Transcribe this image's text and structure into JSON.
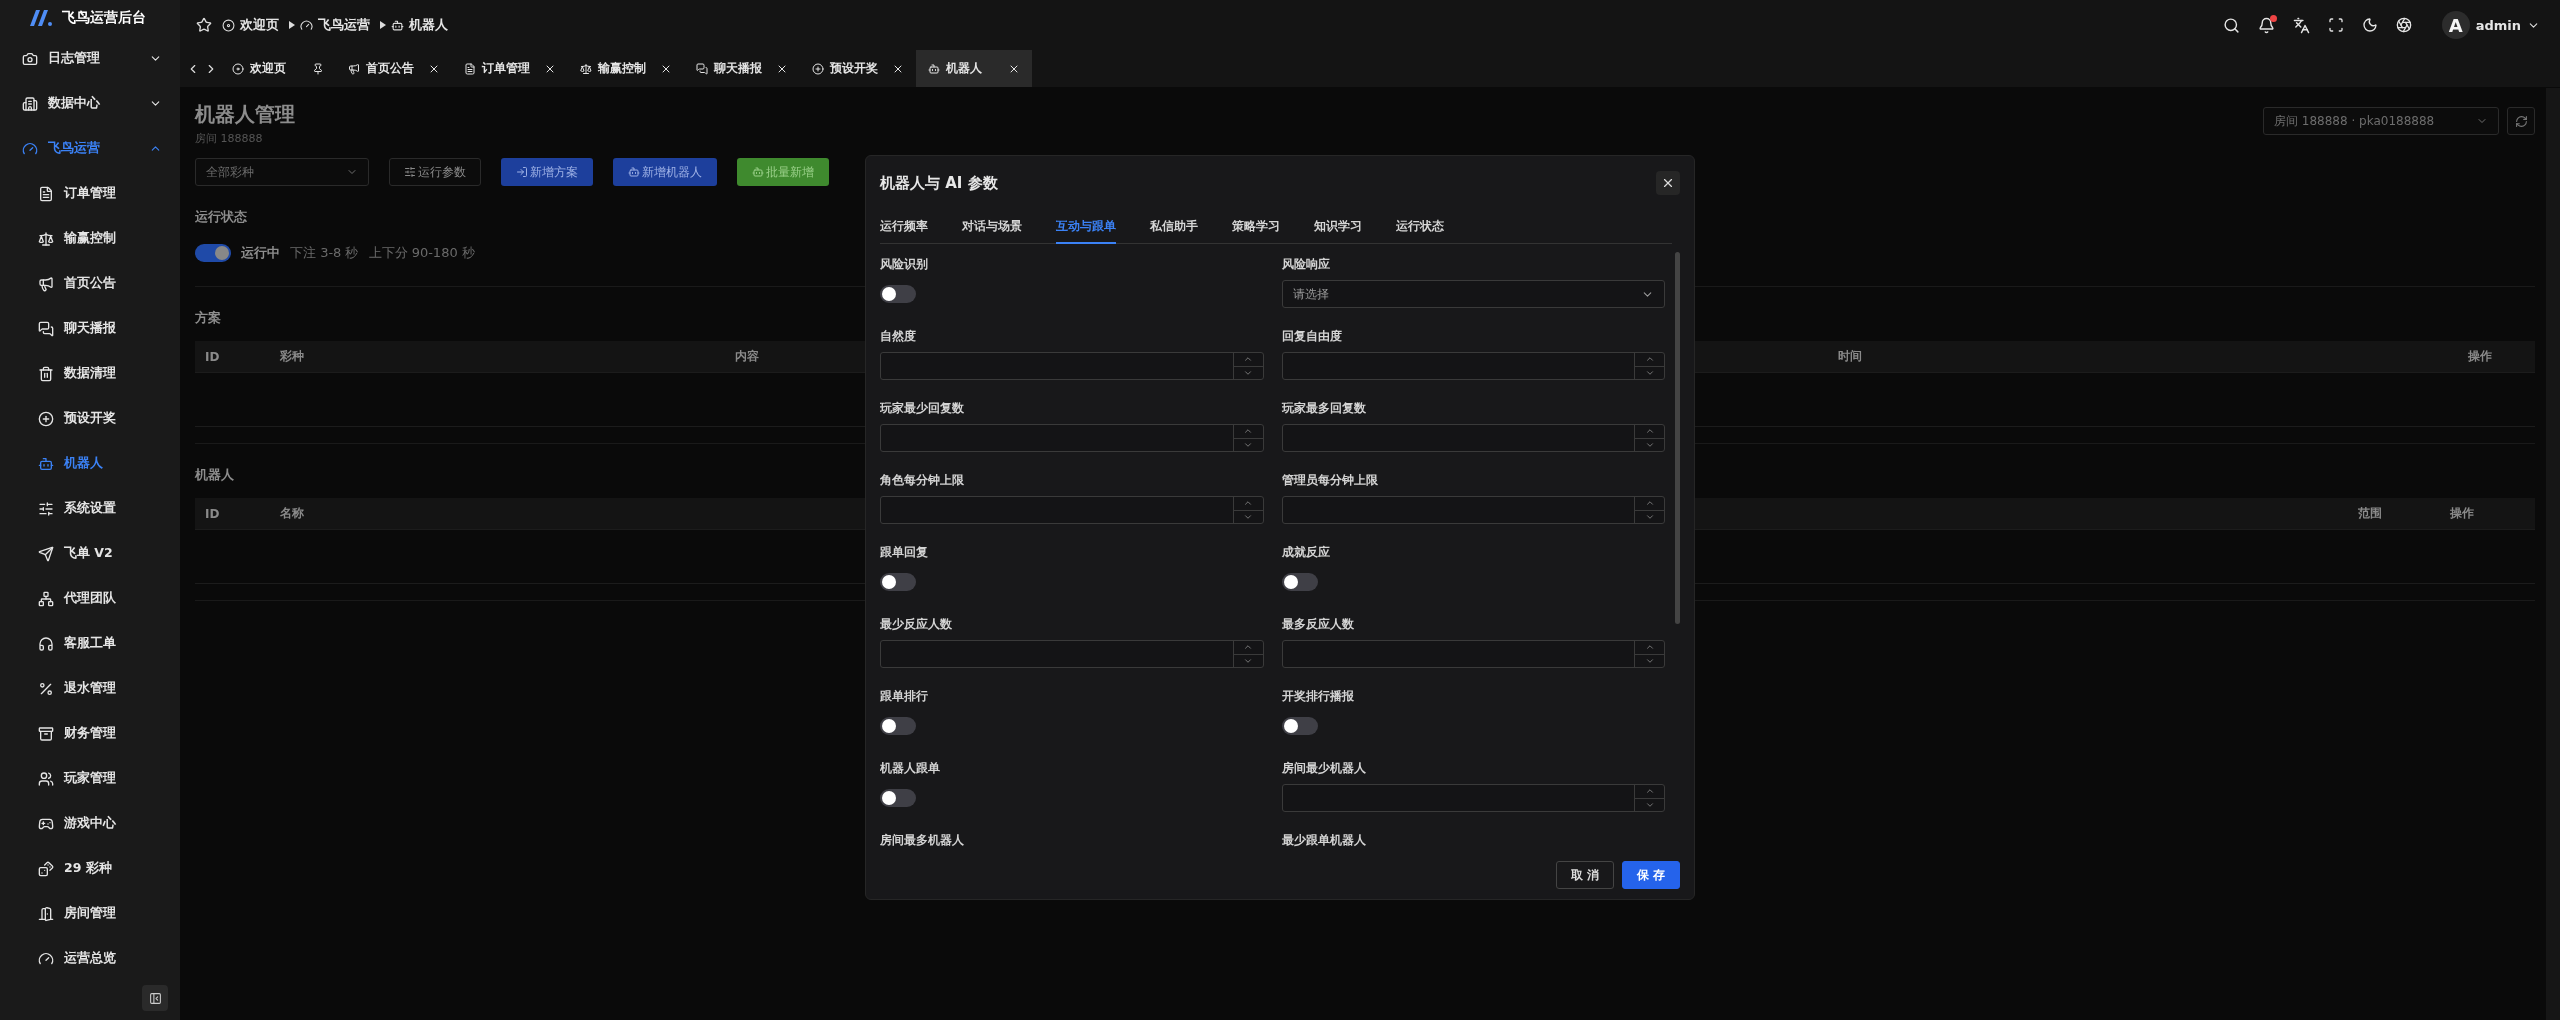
{
  "app": {
    "title": "飞鸟运营后台"
  },
  "sidebar": {
    "items": [
      {
        "label": "日志管理",
        "expanded": false,
        "selected": false
      },
      {
        "label": "数据中心",
        "expanded": false,
        "selected": false
      },
      {
        "label": "飞鸟运营",
        "expanded": true,
        "selected": true,
        "children": [
          {
            "label": "订单管理",
            "selected": false
          },
          {
            "label": "输赢控制",
            "selected": false
          },
          {
            "label": "首页公告",
            "selected": false
          },
          {
            "label": "聊天播报",
            "selected": false
          },
          {
            "label": "数据清理",
            "selected": false
          },
          {
            "label": "预设开奖",
            "selected": false
          },
          {
            "label": "机器人",
            "selected": true
          },
          {
            "label": "系统设置",
            "selected": false
          },
          {
            "label": "飞单 V2",
            "selected": false
          },
          {
            "label": "代理团队",
            "selected": false
          },
          {
            "label": "客服工单",
            "selected": false
          },
          {
            "label": "退水管理",
            "selected": false
          },
          {
            "label": "财务管理",
            "selected": false
          },
          {
            "label": "玩家管理",
            "selected": false
          },
          {
            "label": "游戏中心",
            "selected": false
          },
          {
            "label": "29 彩种",
            "selected": false
          },
          {
            "label": "房间管理",
            "selected": false
          },
          {
            "label": "运营总览",
            "selected": false
          }
        ]
      }
    ]
  },
  "breadcrumb": [
    "欢迎页",
    "飞鸟运营",
    "机器人"
  ],
  "notifications": {
    "unread": true
  },
  "user": {
    "avatar": "A",
    "name": "admin"
  },
  "tabs": [
    {
      "label": "欢迎页",
      "pinned": true,
      "selected": false
    },
    {
      "label": "首页公告",
      "pinned": false,
      "selected": false
    },
    {
      "label": "订单管理",
      "pinned": false,
      "selected": false
    },
    {
      "label": "输赢控制",
      "pinned": false,
      "selected": false
    },
    {
      "label": "聊天播报",
      "pinned": false,
      "selected": false
    },
    {
      "label": "预设开奖",
      "pinned": false,
      "selected": false
    },
    {
      "label": "机器人",
      "pinned": false,
      "selected": true
    }
  ],
  "page": {
    "title": "机器人管理",
    "subtitle": "房间 188888",
    "room_select": {
      "value": "房间 188888 · pka0188888"
    }
  },
  "toolbar": {
    "filter": {
      "value": "全部彩种"
    },
    "buttons": [
      {
        "label": "运行参数",
        "kind": "outline"
      },
      {
        "label": "新增方案",
        "kind": "primary"
      },
      {
        "label": "新增机器人",
        "kind": "primary"
      },
      {
        "label": "批量新增",
        "kind": "success"
      }
    ]
  },
  "status": {
    "title": "运行状态",
    "on": true,
    "label": "运行中",
    "bet_interval": "下注 3-8 秒",
    "score_interval": "上下分 90-180 秒"
  },
  "tables": [
    {
      "title": "方案",
      "columns": [
        "ID",
        "彩种",
        "内容",
        "时间",
        "操作"
      ]
    },
    {
      "title": "机器人",
      "columns": [
        "ID",
        "名称",
        "范围",
        "操作"
      ]
    }
  ],
  "dialog": {
    "title": "机器人与 AI 参数",
    "tabs": [
      {
        "label": "运行频率",
        "selected": false
      },
      {
        "label": "对话与场景",
        "selected": false
      },
      {
        "label": "互动与跟单",
        "selected": true
      },
      {
        "label": "私信助手",
        "selected": false
      },
      {
        "label": "策略学习",
        "selected": false
      },
      {
        "label": "知识学习",
        "selected": false
      },
      {
        "label": "运行状态",
        "selected": false
      }
    ],
    "fields": [
      {
        "label": "风险识别",
        "kind": "toggle",
        "on": false
      },
      {
        "label": "风险响应",
        "kind": "select",
        "placeholder": "请选择"
      },
      {
        "label": "自然度",
        "kind": "number"
      },
      {
        "label": "回复自由度",
        "kind": "number"
      },
      {
        "label": "玩家最少回复数",
        "kind": "number"
      },
      {
        "label": "玩家最多回复数",
        "kind": "number"
      },
      {
        "label": "角色每分钟上限",
        "kind": "number"
      },
      {
        "label": "管理员每分钟上限",
        "kind": "number"
      },
      {
        "label": "跟单回复",
        "kind": "toggle",
        "on": false
      },
      {
        "label": "成就反应",
        "kind": "toggle",
        "on": false
      },
      {
        "label": "最少反应人数",
        "kind": "number"
      },
      {
        "label": "最多反应人数",
        "kind": "number"
      },
      {
        "label": "跟单排行",
        "kind": "toggle",
        "on": false
      },
      {
        "label": "开奖排行播报",
        "kind": "toggle",
        "on": false
      },
      {
        "label": "机器人跟单",
        "kind": "toggle",
        "on": false
      },
      {
        "label": "房间最少机器人",
        "kind": "number"
      },
      {
        "label": "房间最多机器人",
        "kind": "partial"
      },
      {
        "label": "最少跟单机器人",
        "kind": "partial"
      }
    ],
    "buttons": [
      {
        "label": "取 消",
        "kind": "secondary"
      },
      {
        "label": "保 存",
        "kind": "primary"
      }
    ]
  }
}
